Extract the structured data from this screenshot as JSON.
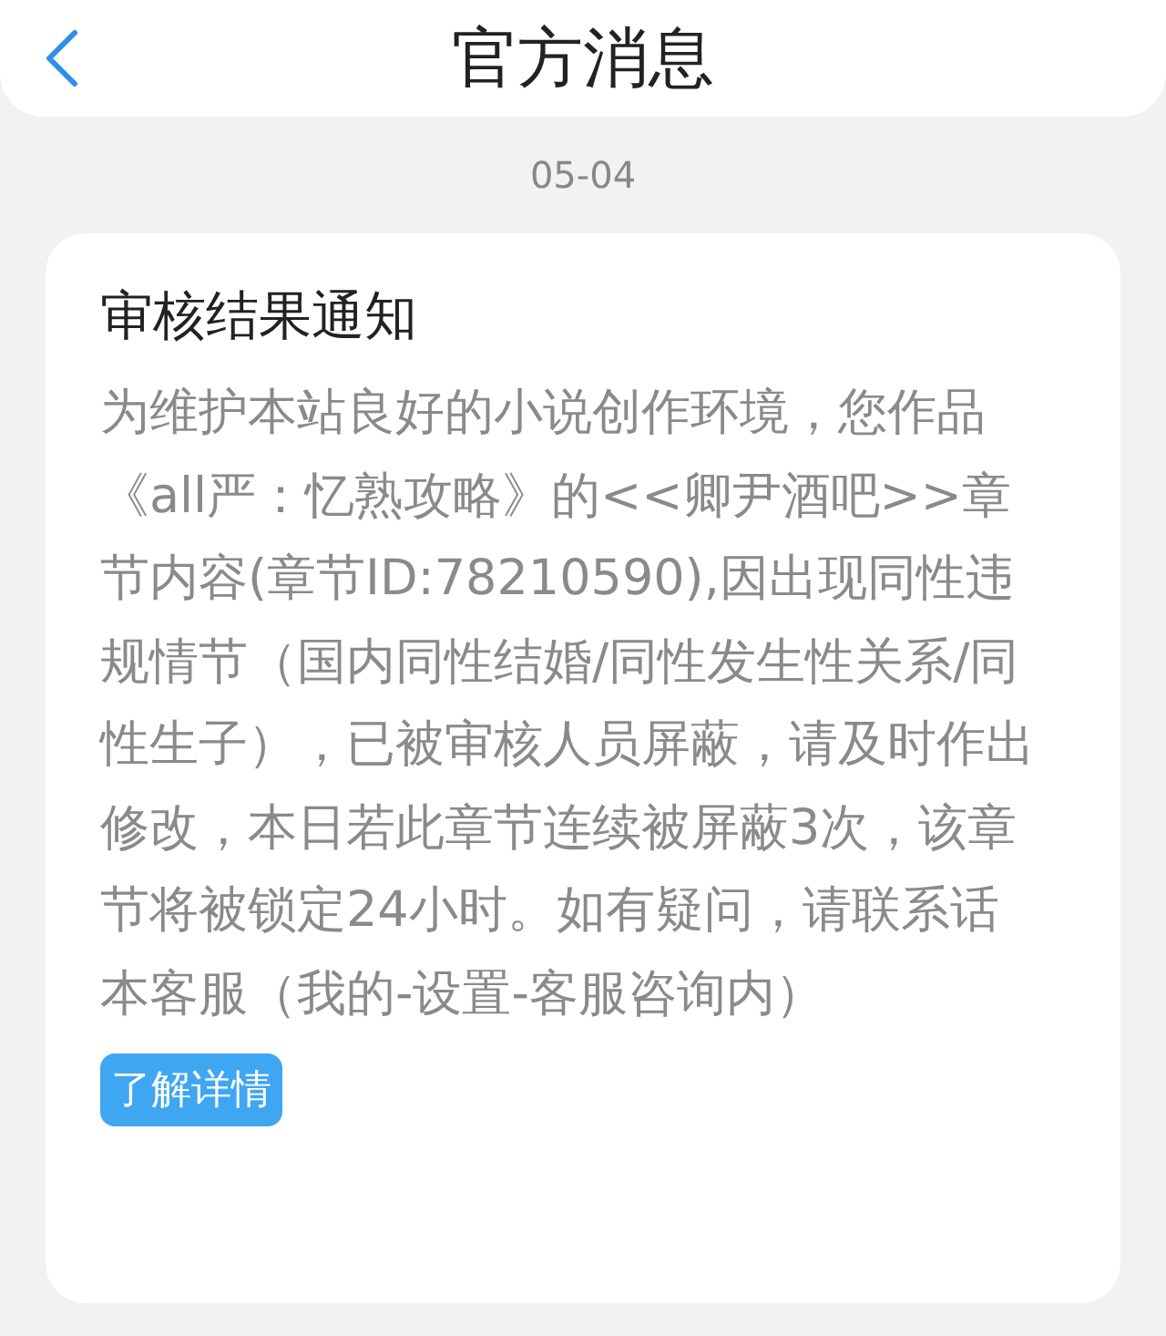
{
  "header": {
    "title": "官方消息"
  },
  "date": "05-04",
  "message": {
    "title": "审核结果通知",
    "body": "为维护本站良好的小说创作环境，您作品《all严：忆熟攻略》的<<卿尹酒吧>>章节内容(章节ID:78210590),因出现同性违规情节（国内同性结婚/同性发生性关系/同性生子），已被审核人员屏蔽，请及时作出修改，本日若此章节连续被屏蔽3次，该章节将被锁定24小时。如有疑问，请联系话本客服（我的-设置-客服咨询内）",
    "button": "了解详情"
  }
}
